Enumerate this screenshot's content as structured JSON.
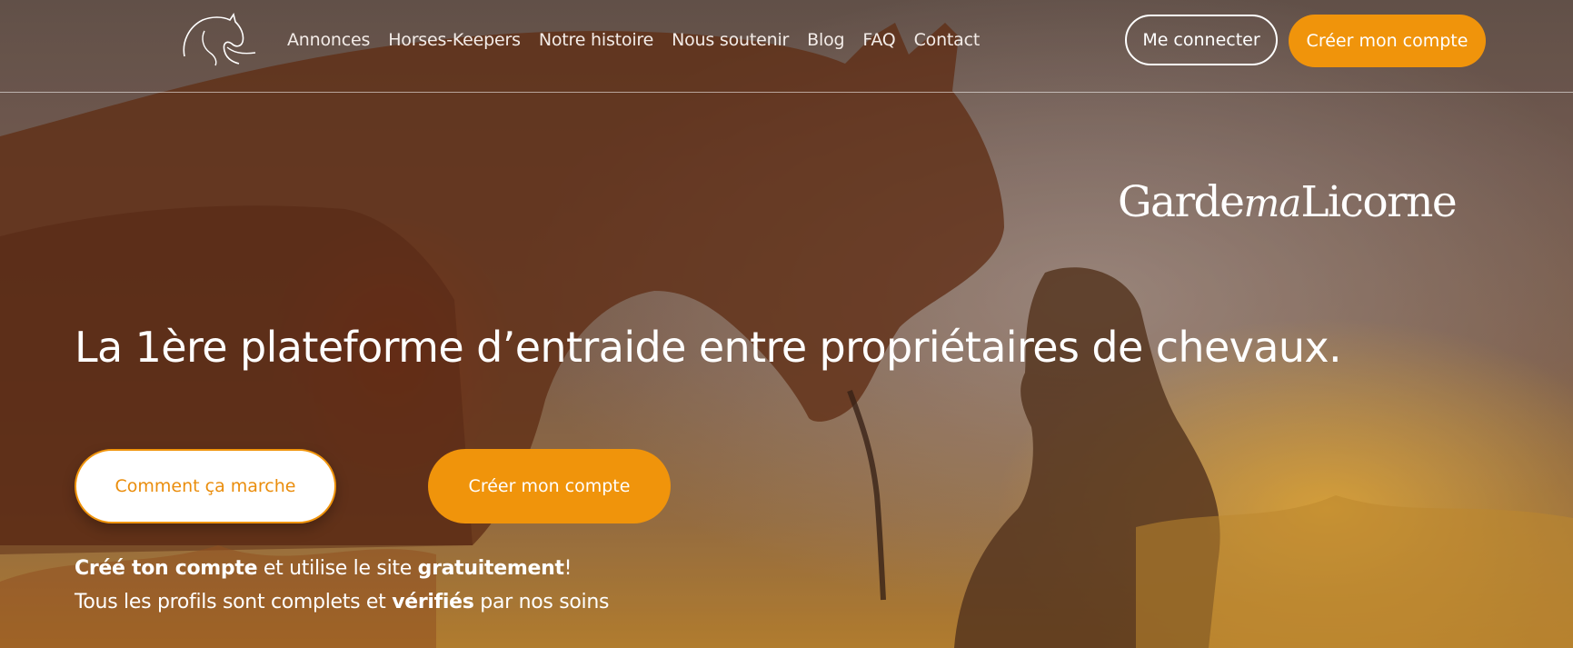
{
  "header": {
    "nav": [
      {
        "label": "Annonces"
      },
      {
        "label": "Horses-Keepers"
      },
      {
        "label": "Notre histoire"
      },
      {
        "label": "Nous soutenir"
      },
      {
        "label": "Blog"
      },
      {
        "label": "FAQ"
      },
      {
        "label": "Contact"
      }
    ],
    "login_label": "Me connecter",
    "create_account_label": "Créer mon compte"
  },
  "brand": {
    "part1": "Garde",
    "part2": "ma",
    "part3": "Licorne"
  },
  "hero": {
    "headline": "La 1ère plateforme d’entraide entre propriétaires de chevaux.",
    "how_it_works_label": "Comment ça marche",
    "create_account_label": "Créer mon compte",
    "line1": {
      "bold1": "Créé ton compte",
      "text1": " et utilise le site ",
      "bold2": "gratuitement",
      "text2": "!"
    },
    "line2": {
      "text1": "Tous les profils sont complets et ",
      "bold1": "vérifiés",
      "text2": " par nos soins"
    }
  },
  "colors": {
    "accent": "#f0940b",
    "text": "#ffffff"
  },
  "icons": {
    "logo": "horse-head-logo"
  }
}
